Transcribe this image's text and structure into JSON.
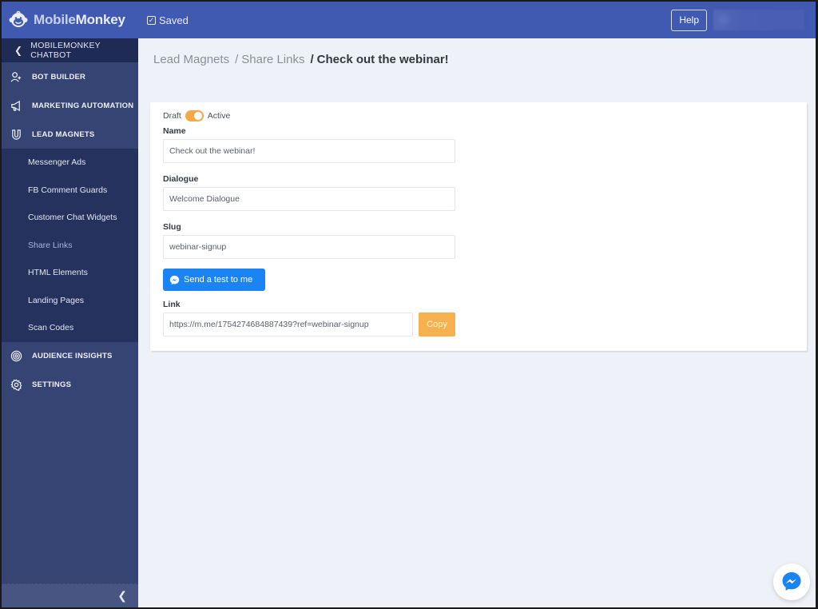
{
  "app": {
    "brand": {
      "name_light": "Mobile",
      "name_bold": "Monkey"
    },
    "save_status": "Saved",
    "help_label": "Help"
  },
  "sidebar": {
    "header": "MOBILEMONKEY CHATBOT",
    "items": [
      {
        "label": "BOT BUILDER",
        "icon": "add-user-icon"
      },
      {
        "label": "MARKETING AUTOMATION",
        "icon": "megaphone-icon"
      },
      {
        "label": "LEAD MAGNETS",
        "icon": "magnet-icon"
      }
    ],
    "sub_items": [
      {
        "label": "Messenger Ads",
        "active": false
      },
      {
        "label": "FB Comment Guards",
        "active": false
      },
      {
        "label": "Customer Chat Widgets",
        "active": false
      },
      {
        "label": "Share Links",
        "active": true
      },
      {
        "label": "HTML Elements",
        "active": false
      },
      {
        "label": "Landing Pages",
        "active": false
      },
      {
        "label": "Scan Codes",
        "active": false
      }
    ],
    "bottom_items": [
      {
        "label": "AUDIENCE INSIGHTS",
        "icon": "target-icon"
      },
      {
        "label": "SETTINGS",
        "icon": "gear-icon"
      }
    ]
  },
  "breadcrumb": {
    "items": [
      "Lead Magnets",
      "Share Links"
    ],
    "current": "Check out the webinar!"
  },
  "form": {
    "status_off_label": "Draft",
    "status_on_label": "Active",
    "status_active": true,
    "name_label": "Name",
    "name_value": "Check out the webinar!",
    "dialogue_label": "Dialogue",
    "dialogue_value": "Welcome Dialogue",
    "slug_label": "Slug",
    "slug_value": "webinar-signup",
    "send_test_label": "Send a test to me",
    "link_label": "Link",
    "link_value": "https://m.me/1754274684887439?ref=webinar-signup",
    "copy_label": "Copy"
  },
  "colors": {
    "topbar": "#4059b1",
    "sidebar": "#364473",
    "sidebar_sub": "#26325e",
    "accent_orange": "#f7b04e",
    "messenger_blue": "#1a84f5"
  }
}
